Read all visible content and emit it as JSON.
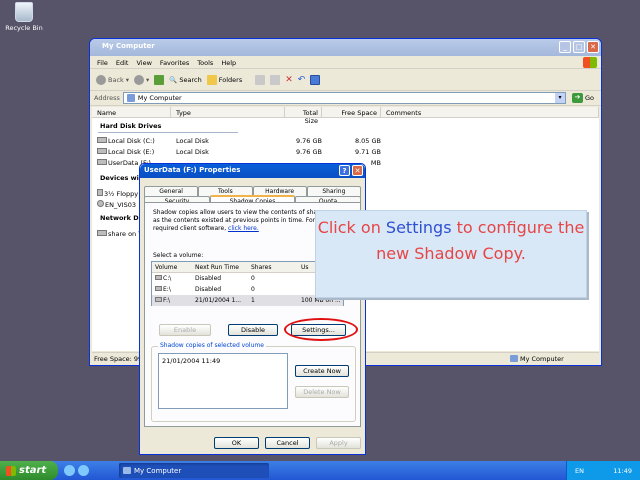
{
  "desktop": {
    "recycle_bin": "Recycle Bin"
  },
  "explorer": {
    "title": "My Computer",
    "menu": [
      "File",
      "Edit",
      "View",
      "Favorites",
      "Tools",
      "Help"
    ],
    "toolbar": {
      "back": "Back",
      "search": "Search",
      "folders": "Folders"
    },
    "address_label": "Address",
    "address_value": "My Computer",
    "go": "Go",
    "columns": [
      "Name",
      "Type",
      "Total Size",
      "Free Space",
      "Comments"
    ],
    "group_hdd": "Hard Disk Drives",
    "drives": [
      {
        "name": "Local Disk (C:)",
        "type": "Local Disk",
        "total": "9.76 GB",
        "free": "8.05 GB"
      },
      {
        "name": "Local Disk (E:)",
        "type": "Local Disk",
        "total": "9.76 GB",
        "free": "9.71 GB"
      },
      {
        "name": "UserData (F:)",
        "type": "",
        "total": "",
        "free": "MB"
      }
    ],
    "group_removable": "Devices wi",
    "removable": [
      "3½ Floppy",
      "EN_VIS03"
    ],
    "group_network": "Network D",
    "network": [
      "share on Y"
    ],
    "status_left": "Free Space: 99",
    "status_right": "My Computer"
  },
  "dialog": {
    "title": "UserData (F:) Properties",
    "help": "?",
    "close": "✕",
    "tabs_row1": [
      "General",
      "Tools",
      "Hardware",
      "Sharing"
    ],
    "tabs_row2": [
      "Security",
      "Shadow Copies",
      "Quota"
    ],
    "desc_1": "Shadow copies allow users to view the contents of shar",
    "desc_2": "as the contents existed at previous points in time. For inf",
    "desc_3": "required client software,",
    "desc_link": "click here.",
    "select_label": "Select a volume:",
    "vol_columns": [
      "Volume",
      "Next Run Time",
      "Shares",
      "Us"
    ],
    "volumes": [
      {
        "vol": "C:\\",
        "next": "Disabled",
        "shares": "0",
        "used": ""
      },
      {
        "vol": "E:\\",
        "next": "Disabled",
        "shares": "0",
        "used": ""
      },
      {
        "vol": "F:\\",
        "next": "21/01/2004 1...",
        "shares": "1",
        "used": "100 MB on ..."
      }
    ],
    "enable": "Enable",
    "disable": "Disable",
    "settings": "Settings...",
    "group_label": "Shadow copies of selected volume",
    "copies": [
      "21/01/2004 11:49"
    ],
    "create_now": "Create Now",
    "delete_now": "Delete Now",
    "ok": "OK",
    "cancel": "Cancel",
    "apply": "Apply"
  },
  "callout": {
    "pre": "Click on",
    "highlight": "Settings",
    "post": "to configure the new Shadow Copy."
  },
  "taskbar": {
    "start": "start",
    "task": "My Computer",
    "lang": "EN",
    "clock": "11:49"
  },
  "colors": {
    "highlight_ring": "#e01010",
    "callout_text": "#e74545",
    "callout_highlight": "#2f4fd2"
  }
}
